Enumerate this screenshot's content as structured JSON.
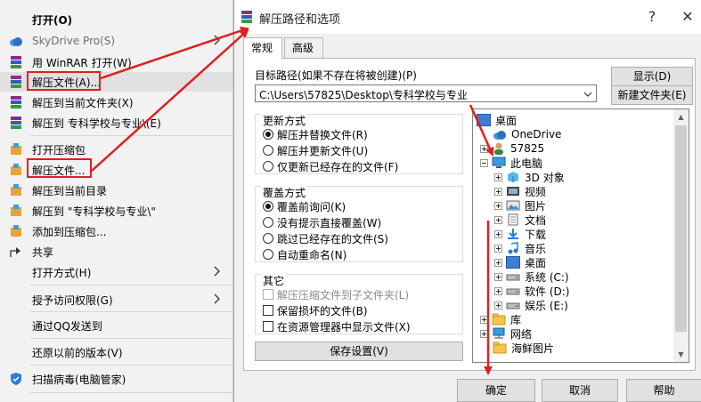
{
  "context_menu": {
    "items": [
      {
        "label": "打开(O)"
      },
      {
        "label": "SkyDrive Pro(S)"
      },
      {
        "label": "用 WinRAR 打开(W)"
      },
      {
        "label": "解压文件(A)..."
      },
      {
        "label": "解压到当前文件夹(X)"
      },
      {
        "label": "解压到 专科学校与专业\\(E)"
      },
      {
        "label": "打开压缩包"
      },
      {
        "label": "解压文件..."
      },
      {
        "label": "解压到当前目录"
      },
      {
        "label": "解压到 \"专科学校与专业\\\""
      },
      {
        "label": "添加到压缩包..."
      },
      {
        "label": "共享"
      },
      {
        "label": "打开方式(H)"
      },
      {
        "label": "授予访问权限(G)"
      },
      {
        "label": "通过QQ发送到"
      },
      {
        "label": "还原以前的版本(V)"
      },
      {
        "label": "扫描病毒(电脑管家)"
      }
    ]
  },
  "dialog": {
    "title": "解压路径和选项",
    "tabs": [
      {
        "label": "常规"
      },
      {
        "label": "高级"
      }
    ],
    "target_label": "目标路径(如果不存在将被创建)(P)",
    "target_path": "C:\\Users\\57825\\Desktop\\专科学校与专业",
    "show_button": "显示(D)",
    "new_folder_button": "新建文件夹(E)",
    "update_mode": {
      "title": "更新方式",
      "options": [
        {
          "label": "解压并替换文件(R)"
        },
        {
          "label": "解压并更新文件(U)"
        },
        {
          "label": "仅更新已经存在的文件(F)"
        }
      ]
    },
    "overwrite_mode": {
      "title": "覆盖方式",
      "options": [
        {
          "label": "覆盖前询问(K)"
        },
        {
          "label": "没有提示直接覆盖(W)"
        },
        {
          "label": "跳过已经存在的文件(S)"
        },
        {
          "label": "自动重命名(N)"
        }
      ]
    },
    "misc": {
      "title": "其它",
      "options": [
        {
          "label": "解压压缩文件到子文件夹(L)"
        },
        {
          "label": "保留损坏的文件(B)"
        },
        {
          "label": "在资源管理器中显示文件(X)"
        }
      ]
    },
    "save_button": "保存设置(V)",
    "tree": [
      {
        "label": "桌面"
      },
      {
        "label": "OneDrive"
      },
      {
        "label": "57825"
      },
      {
        "label": "此电脑"
      },
      {
        "label": "3D 对象"
      },
      {
        "label": "视频"
      },
      {
        "label": "图片"
      },
      {
        "label": "文档"
      },
      {
        "label": "下载"
      },
      {
        "label": "音乐"
      },
      {
        "label": "桌面"
      },
      {
        "label": "系统 (C:)"
      },
      {
        "label": "软件 (D:)"
      },
      {
        "label": "娱乐 (E:)"
      },
      {
        "label": "库"
      },
      {
        "label": "网络"
      },
      {
        "label": "海鲜图片"
      }
    ],
    "ok_button": "确定",
    "cancel_button": "取消",
    "help_button": "帮助"
  },
  "colors": {
    "annotation_red": "#e02020",
    "folder_yellow": "#f3c64a",
    "selected_radio": "#111111"
  }
}
